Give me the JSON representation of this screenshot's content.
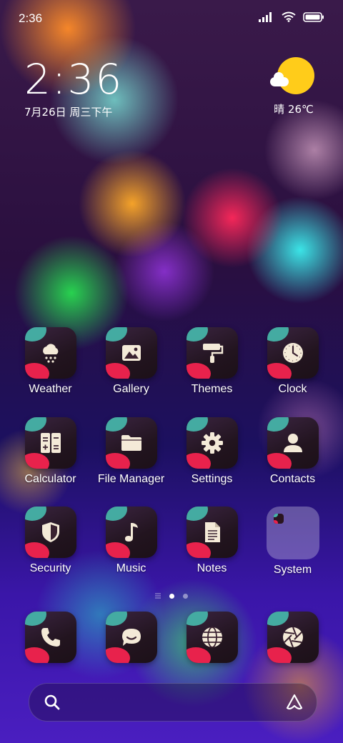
{
  "status_bar": {
    "time": "2:36"
  },
  "clock_widget": {
    "time": "2:36",
    "date": "7月26日 周三下午"
  },
  "weather_widget": {
    "condition": "晴",
    "temperature": "26℃",
    "icon": "sunny-cloud-icon"
  },
  "apps": [
    {
      "label": "Weather",
      "icon": "cloud-snow-icon"
    },
    {
      "label": "Gallery",
      "icon": "image-icon"
    },
    {
      "label": "Themes",
      "icon": "paint-roller-icon"
    },
    {
      "label": "Clock",
      "icon": "clock-icon"
    },
    {
      "label": "Calculator",
      "icon": "calculator-icon"
    },
    {
      "label": "File Manager",
      "icon": "folder-icon"
    },
    {
      "label": "Settings",
      "icon": "gear-icon"
    },
    {
      "label": "Contacts",
      "icon": "person-icon"
    },
    {
      "label": "Security",
      "icon": "shield-icon"
    },
    {
      "label": "Music",
      "icon": "music-note-icon"
    },
    {
      "label": "Notes",
      "icon": "document-icon"
    },
    {
      "label": "System",
      "icon": "folder-group-icon"
    }
  ],
  "page_indicator": {
    "pages": 2,
    "current": 1
  },
  "dock": [
    {
      "icon": "phone-icon"
    },
    {
      "icon": "message-icon"
    },
    {
      "icon": "browser-globe-icon"
    },
    {
      "icon": "camera-aperture-icon"
    }
  ],
  "search_bar": {
    "left_icon": "search-icon",
    "right_icon": "assistant-icon"
  },
  "colors": {
    "icon_teal": "#46b3a8",
    "icon_red": "#e8224c",
    "sun": "#ffcc1a"
  }
}
